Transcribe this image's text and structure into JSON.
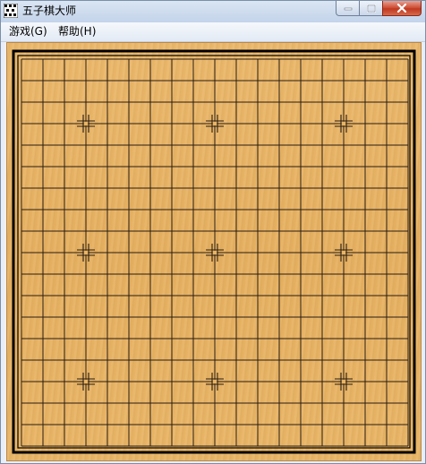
{
  "window": {
    "title": "五子棋大师",
    "icon": "gomoku-app-icon"
  },
  "caption_buttons": {
    "minimize_icon": "minimize-icon",
    "maximize_icon": "maximize-icon",
    "close_icon": "close-icon"
  },
  "menu": {
    "items": [
      {
        "label": "游戏(G)"
      },
      {
        "label": "帮助(H)"
      }
    ]
  },
  "board": {
    "lines": 19,
    "star_points": [
      [
        3,
        3
      ],
      [
        9,
        3
      ],
      [
        15,
        3
      ],
      [
        3,
        9
      ],
      [
        9,
        9
      ],
      [
        15,
        9
      ],
      [
        3,
        15
      ],
      [
        9,
        15
      ],
      [
        15,
        15
      ]
    ],
    "colors": {
      "wood": "#e8b464",
      "line": "#2a1d10",
      "frame": "#000000"
    }
  }
}
